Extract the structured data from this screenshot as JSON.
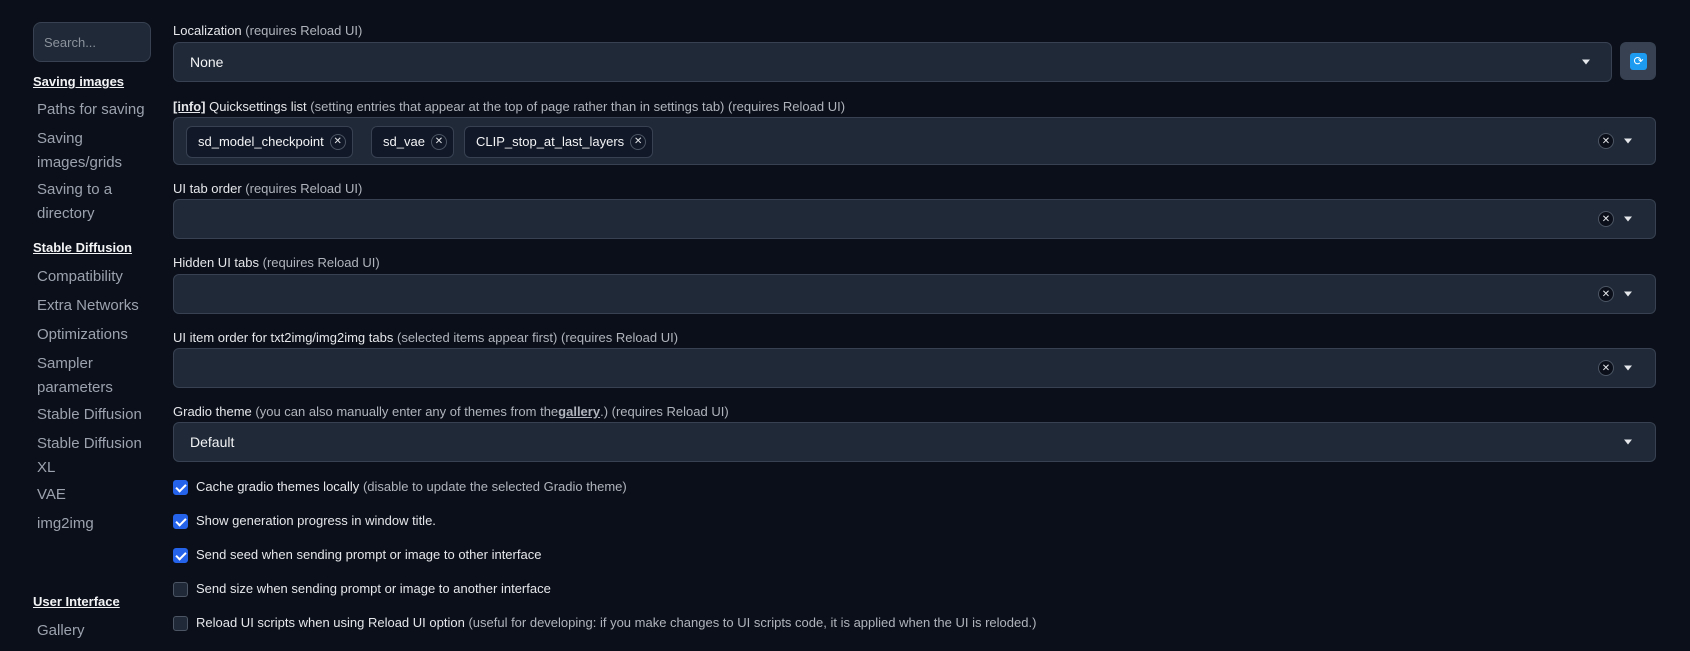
{
  "sidebar": {
    "search_placeholder": "Search...",
    "sections": [
      {
        "title": "Saving images",
        "items": [
          "Paths for saving",
          "Saving images/grids",
          "Saving to a directory"
        ]
      },
      {
        "title": "Stable Diffusion",
        "items": [
          "Compatibility",
          "Extra Networks",
          "Optimizations",
          "Sampler parameters",
          "Stable Diffusion",
          "Stable Diffusion XL",
          "VAE",
          "img2img"
        ]
      },
      {
        "title": "User Interface",
        "items": [
          "Gallery"
        ]
      }
    ]
  },
  "settings": {
    "localization": {
      "label": "Localization",
      "hint": "(requires Reload UI)",
      "value": "None"
    },
    "quicksettings": {
      "info_link": "[info]",
      "label": "Quicksettings list",
      "hint": "(setting entries that appear at the top of page rather than in settings tab) (requires Reload UI)",
      "chips": [
        "sd_model_checkpoint",
        "sd_vae",
        "CLIP_stop_at_last_layers"
      ]
    },
    "tab_order": {
      "label": "UI tab order",
      "hint": "(requires Reload UI)"
    },
    "hidden_tabs": {
      "label": "Hidden UI tabs",
      "hint": "(requires Reload UI)"
    },
    "item_order": {
      "label": "UI item order for txt2img/img2img tabs",
      "hint": "(selected items appear first) (requires Reload UI)"
    },
    "theme": {
      "label": "Gradio theme",
      "hint_before": "(you can also manually enter any of themes from the",
      "link": "gallery",
      "hint_after": ".) (requires Reload UI)",
      "value": "Default"
    },
    "checkboxes": [
      {
        "label": "Cache gradio themes locally",
        "hint": "(disable to update the selected Gradio theme)",
        "checked": true
      },
      {
        "label": "Show generation progress in window title.",
        "hint": "",
        "checked": true
      },
      {
        "label": "Send seed when sending prompt or image to other interface",
        "hint": "",
        "checked": true
      },
      {
        "label": "Send size when sending prompt or image to another interface",
        "hint": "",
        "checked": false
      },
      {
        "label": "Reload UI scripts when using Reload UI option",
        "hint": "(useful for developing: if you make changes to UI scripts code, it is applied when the UI is reloded.)",
        "checked": false
      }
    ]
  },
  "icons": {
    "refresh": "refresh-icon",
    "clear": "close-icon",
    "dropdown": "chevron-down-icon",
    "check": "check-icon"
  },
  "colors": {
    "accent": "#2563eb",
    "background": "#0b0f19",
    "field": "#1f2937",
    "refresh_icon": "#1d9bf0"
  }
}
